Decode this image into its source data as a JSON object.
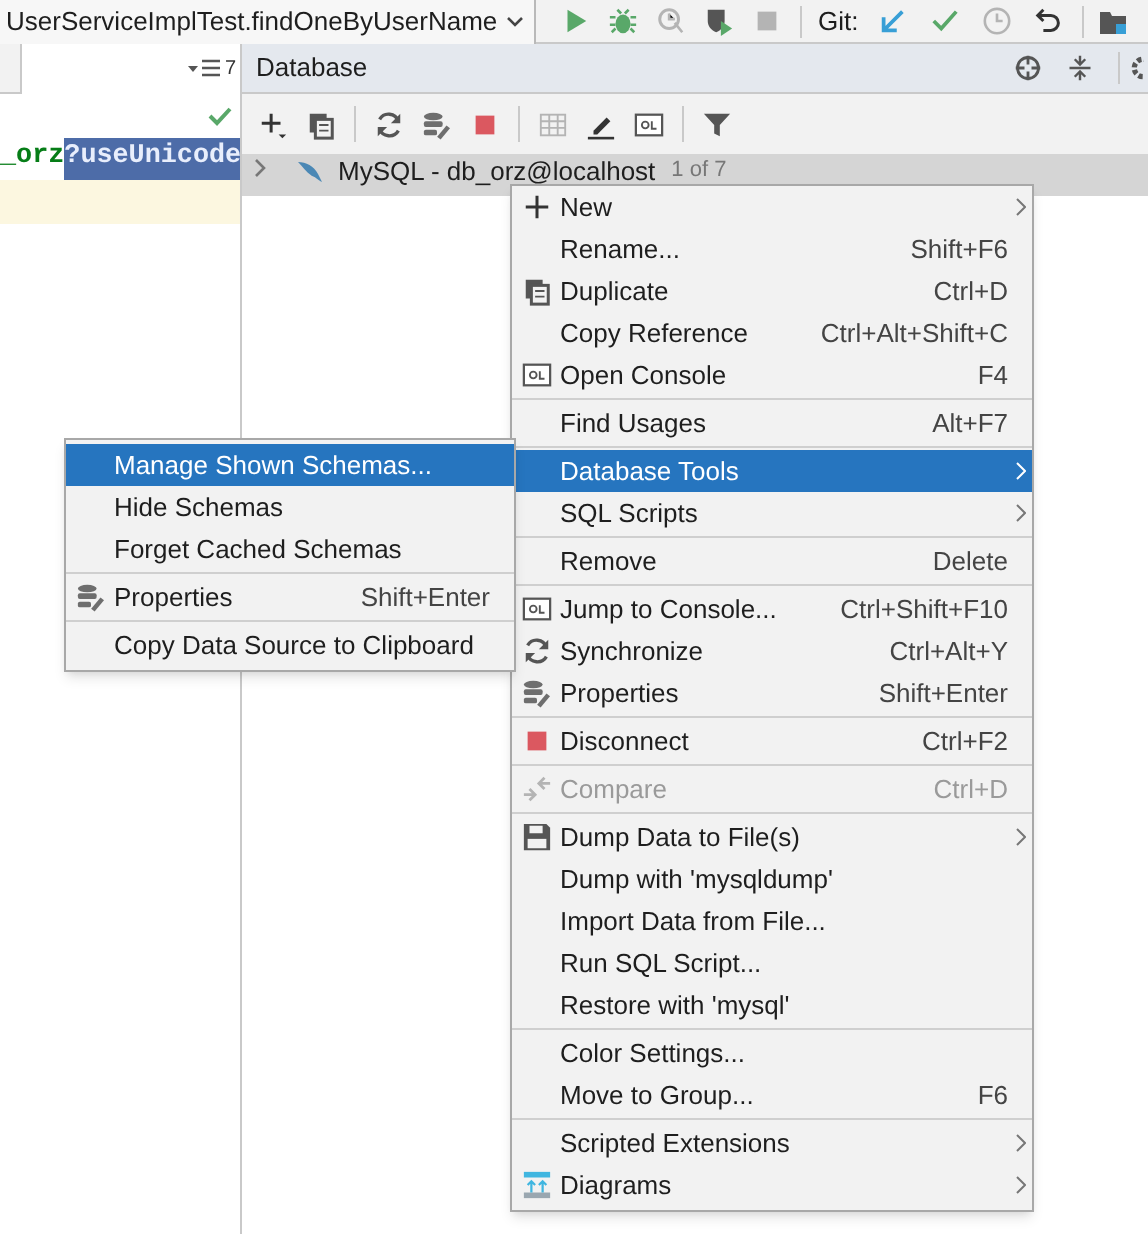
{
  "toolbar": {
    "run_config": "UserServiceImplTest.findOneByUserName",
    "actions": [
      {
        "kind": "run",
        "disabled": false
      },
      {
        "kind": "debug",
        "disabled": false
      },
      {
        "kind": "coverage",
        "disabled": true
      },
      {
        "kind": "profile",
        "disabled": false
      },
      {
        "kind": "stop",
        "disabled": true
      }
    ],
    "git_label": "Git:",
    "git_actions": [
      {
        "kind": "update",
        "disabled": false
      },
      {
        "kind": "commit",
        "disabled": false
      },
      {
        "kind": "history",
        "disabled": true
      },
      {
        "kind": "rollback",
        "disabled": false
      }
    ]
  },
  "editor": {
    "tab_count": "7",
    "code": "_orz",
    "selected_code": "?useUnicode"
  },
  "database_panel": {
    "title": "Database",
    "actions": [
      {
        "kind": "add",
        "disabled": false
      },
      {
        "kind": "copy",
        "disabled": false
      },
      {
        "kind": "sep"
      },
      {
        "kind": "refresh",
        "disabled": false
      },
      {
        "kind": "props",
        "disabled": false
      },
      {
        "kind": "stop",
        "disabled": false
      },
      {
        "kind": "sep"
      },
      {
        "kind": "table",
        "disabled": true
      },
      {
        "kind": "edit",
        "disabled": false
      },
      {
        "kind": "console",
        "disabled": false
      },
      {
        "kind": "sep"
      },
      {
        "kind": "filter",
        "disabled": false
      }
    ],
    "tree": [
      {
        "label": "MySQL - db_orz@localhost",
        "hint": "1 of 7",
        "expanded": false,
        "selected": true
      }
    ]
  },
  "context_menu": {
    "groups": [
      [
        {
          "kind": "plus",
          "label": "New",
          "submenu": true,
          "selected": false,
          "disabled": false
        },
        {
          "kind": "plain",
          "label": "Rename...",
          "shortcut": "Shift+F6",
          "submenu": false,
          "selected": false,
          "disabled": false
        },
        {
          "kind": "copy",
          "label": "Duplicate",
          "shortcut": "Ctrl+D",
          "submenu": false,
          "selected": false,
          "disabled": false
        },
        {
          "kind": "plain",
          "label": "Copy Reference",
          "shortcut": "Ctrl+Alt+Shift+C",
          "submenu": false,
          "selected": false,
          "disabled": false
        },
        {
          "kind": "console",
          "label": "Open Console",
          "shortcut": "F4",
          "submenu": false,
          "selected": false,
          "disabled": false
        }
      ],
      [
        {
          "kind": "plain",
          "label": "Find Usages",
          "shortcut": "Alt+F7",
          "submenu": false,
          "selected": false,
          "disabled": false
        }
      ],
      [
        {
          "kind": "plain",
          "label": "Database Tools",
          "submenu": true,
          "selected": true,
          "disabled": false
        },
        {
          "kind": "plain",
          "label": "SQL Scripts",
          "submenu": true,
          "selected": false,
          "disabled": false
        }
      ],
      [
        {
          "kind": "plain",
          "label": "Remove",
          "shortcut": "Delete",
          "submenu": false,
          "selected": false,
          "disabled": false
        }
      ],
      [
        {
          "kind": "console",
          "label": "Jump to Console...",
          "shortcut": "Ctrl+Shift+F10",
          "submenu": false,
          "selected": false,
          "disabled": false
        },
        {
          "kind": "refresh",
          "label": "Synchronize",
          "shortcut": "Ctrl+Alt+Y",
          "submenu": false,
          "selected": false,
          "disabled": false
        },
        {
          "kind": "props",
          "label": "Properties",
          "shortcut": "Shift+Enter",
          "submenu": false,
          "selected": false,
          "disabled": false
        }
      ],
      [
        {
          "kind": "stop",
          "label": "Disconnect",
          "shortcut": "Ctrl+F2",
          "submenu": false,
          "selected": false,
          "disabled": false
        }
      ],
      [
        {
          "kind": "compare",
          "label": "Compare",
          "shortcut": "Ctrl+D",
          "submenu": false,
          "selected": false,
          "disabled": true
        }
      ],
      [
        {
          "kind": "save",
          "label": "Dump Data to File(s)",
          "submenu": true,
          "selected": false,
          "disabled": false
        },
        {
          "kind": "plain",
          "label": "Dump with 'mysqldump'",
          "submenu": false,
          "selected": false,
          "disabled": false
        },
        {
          "kind": "plain",
          "label": "Import Data from File...",
          "submenu": false,
          "selected": false,
          "disabled": false
        },
        {
          "kind": "plain",
          "label": "Run SQL Script...",
          "submenu": false,
          "selected": false,
          "disabled": false
        },
        {
          "kind": "plain",
          "label": "Restore with 'mysql'",
          "submenu": false,
          "selected": false,
          "disabled": false
        }
      ],
      [
        {
          "kind": "plain",
          "label": "Color Settings...",
          "submenu": false,
          "selected": false,
          "disabled": false
        },
        {
          "kind": "plain",
          "label": "Move to Group...",
          "shortcut": "F6",
          "submenu": false,
          "selected": false,
          "disabled": false
        }
      ],
      [
        {
          "kind": "plain",
          "label": "Scripted Extensions",
          "submenu": true,
          "selected": false,
          "disabled": false
        },
        {
          "kind": "diagram",
          "label": "Diagrams",
          "submenu": true,
          "selected": false,
          "disabled": false
        }
      ]
    ]
  },
  "submenu": {
    "groups": [
      [
        {
          "kind": "plain",
          "label": "Manage Shown Schemas...",
          "submenu": false,
          "selected": true,
          "disabled": false
        },
        {
          "kind": "plain",
          "label": "Hide Schemas",
          "submenu": false,
          "selected": false,
          "disabled": false
        },
        {
          "kind": "plain",
          "label": "Forget Cached Schemas",
          "submenu": false,
          "selected": false,
          "disabled": false
        }
      ],
      [
        {
          "kind": "props",
          "label": "Properties",
          "shortcut": "Shift+Enter",
          "submenu": false,
          "selected": false,
          "disabled": false
        }
      ],
      [
        {
          "kind": "plain",
          "label": "Copy Data Source to Clipboard",
          "submenu": false,
          "selected": false,
          "disabled": false
        }
      ]
    ]
  }
}
